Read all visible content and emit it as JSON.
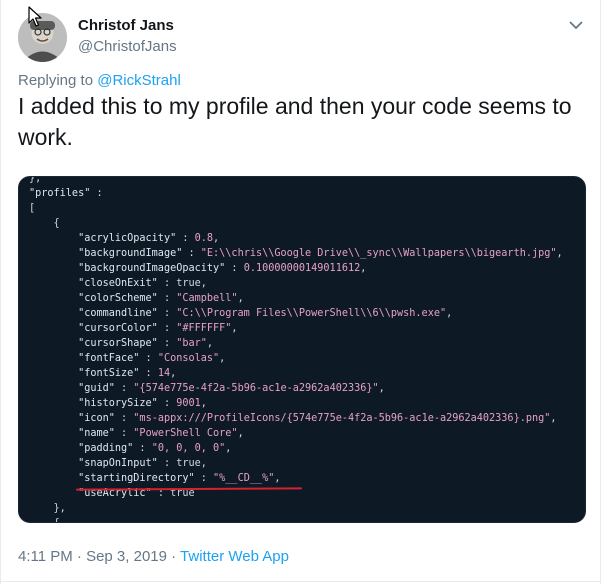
{
  "author": {
    "name": "Christof Jans",
    "handle": "@ChristofJans"
  },
  "reply": {
    "prefix": "Replying to ",
    "mention": "@RickStrahl"
  },
  "tweet": {
    "text": "I added this to my profile and then your code seems to work."
  },
  "code_lines": [
    "},",
    "\"profiles\" :",
    "[",
    "    {",
    "        \"acrylicOpacity\" : 0.8,",
    "        \"backgroundImage\" : \"E:\\\\chris\\\\Google Drive\\\\_sync\\\\Wallpapers\\\\bigearth.jpg\",",
    "        \"backgroundImageOpacity\" : 0.10000000149011612,",
    "        \"closeOnExit\" : true,",
    "        \"colorScheme\" : \"Campbell\",",
    "        \"commandline\" : \"C:\\\\Program Files\\\\PowerShell\\\\6\\\\pwsh.exe\",",
    "        \"cursorColor\" : \"#FFFFFF\",",
    "        \"cursorShape\" : \"bar\",",
    "        \"fontFace\" : \"Consolas\",",
    "        \"fontSize\" : 14,",
    "        \"guid\" : \"{574e775e-4f2a-5b96-ac1e-a2962a402336}\",",
    "        \"historySize\" : 9001,",
    "        \"icon\" : \"ms-appx:///ProfileIcons/{574e775e-4f2a-5b96-ac1e-a2962a402336}.png\",",
    "        \"name\" : \"PowerShell Core\",",
    "        \"padding\" : \"0, 0, 0, 0\",",
    "        \"snapOnInput\" : true,",
    "        \"startingDirectory\" : \"%__CD__%\",",
    "        \"useAcrylic\" : true",
    "    },",
    "    {"
  ],
  "meta": {
    "time": "4:11 PM · Sep 3, 2019 · ",
    "app": "Twitter Web App"
  },
  "icons": {
    "menu": "chevron-down-icon",
    "pointer": "mouse-cursor-icon"
  },
  "colors": {
    "link": "#1da1f2",
    "secondary_text": "#657786",
    "code_bg": "#0d1a26",
    "underline": "#d6212e"
  }
}
